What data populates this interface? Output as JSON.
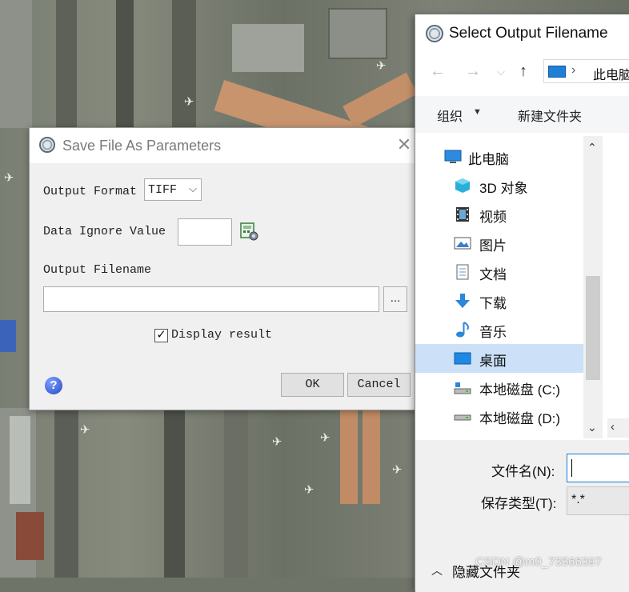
{
  "save_dialog": {
    "title": "Save File As Parameters",
    "output_format_label": "Output Format",
    "output_format_value": "TIFF",
    "data_ignore_label": "Data Ignore Value",
    "data_ignore_value": "",
    "output_filename_label": "Output Filename",
    "output_filename_value": "",
    "browse_label": "...",
    "display_result_label": "Display result",
    "display_result_checked": true,
    "help_symbol": "?",
    "ok_label": "OK",
    "cancel_label": "Cancel"
  },
  "file_dialog": {
    "title": "Select Output Filename",
    "address_location": "此电脑",
    "toolbar": {
      "organize": "组织",
      "new_folder": "新建文件夹"
    },
    "tree": [
      {
        "label": "此电脑",
        "icon": "pc-icon",
        "selected": false
      },
      {
        "label": "3D 对象",
        "icon": "3d-objects-icon",
        "selected": false
      },
      {
        "label": "视频",
        "icon": "video-icon",
        "selected": false
      },
      {
        "label": "图片",
        "icon": "pictures-icon",
        "selected": false
      },
      {
        "label": "文档",
        "icon": "documents-icon",
        "selected": false
      },
      {
        "label": "下载",
        "icon": "download-icon",
        "selected": false
      },
      {
        "label": "音乐",
        "icon": "music-icon",
        "selected": false
      },
      {
        "label": "桌面",
        "icon": "desktop-icon",
        "selected": true
      },
      {
        "label": "本地磁盘 (C:)",
        "icon": "drive-c-icon",
        "selected": false
      },
      {
        "label": "本地磁盘 (D:)",
        "icon": "drive-d-icon",
        "selected": false
      }
    ],
    "filename_label": "文件名(N):",
    "filename_value": "",
    "filetype_label": "保存类型(T):",
    "filetype_value": "*.*",
    "hide_folders_label": "隐藏文件夹"
  },
  "watermark": "CSDN @m0_73566397"
}
